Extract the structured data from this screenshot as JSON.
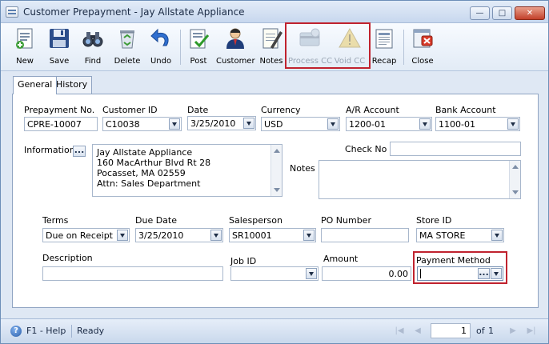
{
  "window": {
    "title": "Customer Prepayment - Jay Allstate Appliance"
  },
  "toolbar": {
    "new": "New",
    "save": "Save",
    "find": "Find",
    "delete": "Delete",
    "undo": "Undo",
    "post": "Post",
    "customer": "Customer",
    "notes": "Notes",
    "process_cc": "Process CC",
    "void_cc": "Void CC",
    "recap": "Recap",
    "close": "Close"
  },
  "tabs": {
    "general": "General",
    "history": "History"
  },
  "form": {
    "prepayment_no": {
      "label": "Prepayment No.",
      "value": "CPRE-10007"
    },
    "customer_id": {
      "label": "Customer ID",
      "value": "C10038"
    },
    "date": {
      "label": "Date",
      "value": "3/25/2010"
    },
    "currency": {
      "label": "Currency",
      "value": "USD"
    },
    "ar_account": {
      "label": "A/R Account",
      "value": "1200-01"
    },
    "bank_account": {
      "label": "Bank Account",
      "value": "1100-01"
    },
    "information": {
      "label": "Information",
      "lines": [
        "Jay Allstate Appliance",
        "160 MacArthur Blvd Rt 28",
        "Pocasset, MA 02559",
        "Attn: Sales Department"
      ]
    },
    "check_no": {
      "label": "Check No",
      "value": ""
    },
    "notes": {
      "label": "Notes",
      "value": ""
    },
    "terms": {
      "label": "Terms",
      "value": "Due on Receipt"
    },
    "due_date": {
      "label": "Due Date",
      "value": "3/25/2010"
    },
    "salesperson": {
      "label": "Salesperson",
      "value": "SR10001"
    },
    "po_number": {
      "label": "PO Number",
      "value": ""
    },
    "store_id": {
      "label": "Store ID",
      "value": "MA STORE"
    },
    "description": {
      "label": "Description",
      "value": ""
    },
    "job_id": {
      "label": "Job ID",
      "value": ""
    },
    "amount": {
      "label": "Amount",
      "value": "0.00"
    },
    "payment_method": {
      "label": "Payment Method",
      "value": ""
    }
  },
  "status": {
    "help": "F1 - Help",
    "state": "Ready",
    "page": "1",
    "of_label": "of",
    "total": "1"
  },
  "colors": {
    "highlight": "#c0222e",
    "accent": "#2b5ea8"
  }
}
